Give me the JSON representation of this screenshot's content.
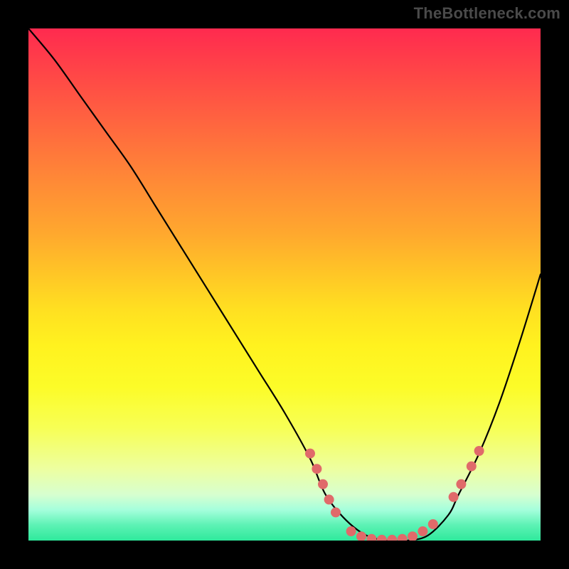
{
  "watermark": "TheBottleneck.com",
  "chart_data": {
    "type": "line",
    "title": "",
    "xlabel": "",
    "ylabel": "",
    "xlim": [
      0,
      100
    ],
    "ylim": [
      0,
      100
    ],
    "grid": false,
    "legend": false,
    "series": [
      {
        "name": "curve",
        "color": "#000000",
        "x": [
          0,
          5,
          10,
          15,
          20,
          25,
          30,
          35,
          40,
          45,
          50,
          55,
          58,
          62,
          66,
          70,
          74,
          78,
          82,
          84,
          88,
          92,
          96,
          100
        ],
        "values": [
          100,
          94,
          87,
          80,
          73,
          65,
          57,
          49,
          41,
          33,
          25,
          16,
          9,
          4,
          1,
          0,
          0,
          1,
          5,
          9,
          17,
          27,
          39,
          52
        ]
      }
    ],
    "markers": [
      {
        "x": 55.0,
        "y": 17.0
      },
      {
        "x": 56.3,
        "y": 14.0
      },
      {
        "x": 57.5,
        "y": 11.0
      },
      {
        "x": 58.7,
        "y": 8.0
      },
      {
        "x": 60.0,
        "y": 5.5
      },
      {
        "x": 63.0,
        "y": 1.8
      },
      {
        "x": 65.0,
        "y": 0.8
      },
      {
        "x": 67.0,
        "y": 0.3
      },
      {
        "x": 69.0,
        "y": 0.15
      },
      {
        "x": 71.0,
        "y": 0.15
      },
      {
        "x": 73.0,
        "y": 0.3
      },
      {
        "x": 75.0,
        "y": 0.8
      },
      {
        "x": 77.0,
        "y": 1.8
      },
      {
        "x": 79.0,
        "y": 3.2
      },
      {
        "x": 83.0,
        "y": 8.5
      },
      {
        "x": 84.5,
        "y": 11.0
      },
      {
        "x": 86.5,
        "y": 14.5
      },
      {
        "x": 88.0,
        "y": 17.5
      }
    ],
    "marker_style": {
      "color": "#e06a6a",
      "radius_px": 7
    }
  }
}
